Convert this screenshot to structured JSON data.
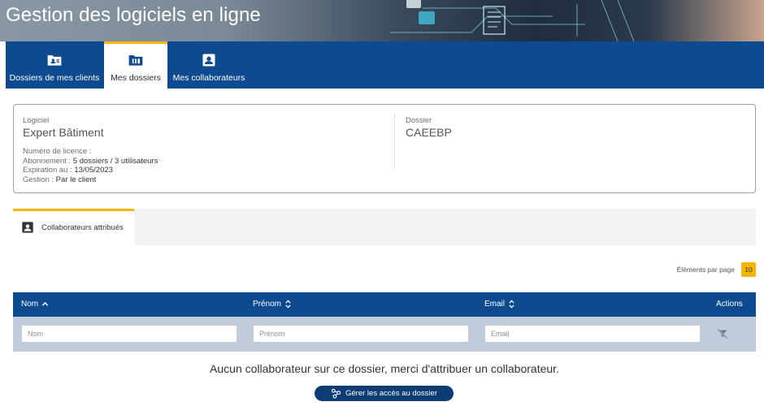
{
  "banner": {
    "title": "Gestion des logiciels en ligne"
  },
  "nav": {
    "tabs": [
      {
        "label": "Dossiers de mes clients",
        "icon": "client-folder-icon"
      },
      {
        "label": "Mes dossiers",
        "icon": "folder-icon",
        "active": true
      },
      {
        "label": "Mes collaborateurs",
        "icon": "person-badge-icon"
      }
    ]
  },
  "info": {
    "logiciel_label": "Logiciel",
    "logiciel_value": "Expert Bâtiment",
    "licence_label": "Numéro de licence :",
    "licence_value": "",
    "abonnement_label": "Abonnement :",
    "abonnement_value": "5 dossiers / 3 utilisateurs",
    "expiration_label": "Expiration au :",
    "expiration_value": "13/05/2023",
    "gestion_label": "Gestion :",
    "gestion_value": "Par le client",
    "dossier_label": "Dossier",
    "dossier_value": "CAEEBP"
  },
  "subtabs": [
    {
      "label": "Collaborateurs attribués",
      "icon": "person-badge-icon"
    }
  ],
  "pager": {
    "label": "Éléments par page",
    "value": "10"
  },
  "table": {
    "columns": [
      {
        "label": "Nom",
        "sort": "ascending"
      },
      {
        "label": "Prénom",
        "sort": "none"
      },
      {
        "label": "Email",
        "sort": "none"
      },
      {
        "label": "Actions"
      }
    ],
    "filters": {
      "nom_placeholder": "Nom",
      "prenom_placeholder": "Prénom",
      "email_placeholder": "Email"
    },
    "clear_filter_icon": "clear-filter-icon"
  },
  "empty": {
    "message": "Aucun collaborateur sur ce dossier, merci d'attribuer un collaborateur.",
    "button_label": "Gérer les accès au dossier",
    "button_icon": "share-nodes-icon"
  },
  "colors": {
    "primary": "#0d4a8f",
    "accent": "#f7b500",
    "filter_row": "#c0ccdc"
  }
}
